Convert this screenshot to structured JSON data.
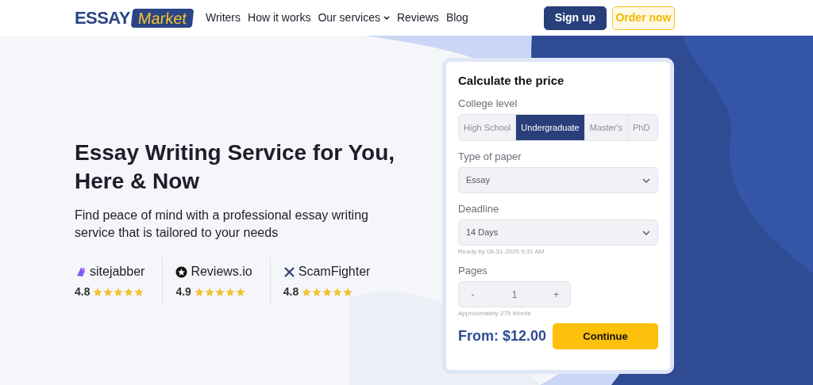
{
  "logo": {
    "word_1": "ESSAY",
    "word_2": "Market"
  },
  "nav": [
    {
      "label": "Writers",
      "has_menu": false
    },
    {
      "label": "How it works",
      "has_menu": false
    },
    {
      "label": "Our services",
      "has_menu": true
    },
    {
      "label": "Reviews",
      "has_menu": false
    },
    {
      "label": "Blog",
      "has_menu": false
    }
  ],
  "header_buttons": [
    {
      "label": "Sign up",
      "kind": "primary"
    },
    {
      "label": "Order now",
      "kind": "outline"
    }
  ],
  "hero": {
    "title": "Essay Writing Service for You, Here & Now",
    "subtitle": "Find peace of mind with a professional essay writing service that is tailored to your needs"
  },
  "ratings": [
    {
      "site": "sitejabber",
      "kind": "sitejabber",
      "score": "4.8",
      "stars": 5
    },
    {
      "site": "Reviews.io",
      "kind": "reviewsio",
      "score": "4.9",
      "stars": 5
    },
    {
      "site": "ScamFighter",
      "kind": "scamfighter",
      "score": "4.8",
      "stars": 5
    }
  ],
  "calculator": {
    "title": "Calculate the price",
    "level_label": "College level",
    "levels": [
      {
        "label": "High School",
        "selected": false
      },
      {
        "label": "Undergraduate",
        "selected": true
      },
      {
        "label": "Master's",
        "selected": false
      },
      {
        "label": "PhD",
        "selected": false
      }
    ],
    "paper_label": "Type of paper",
    "paper_value": "Essay",
    "deadline_label": "Deadline",
    "deadline_value": "14 Days",
    "deadline_note": "Ready by 08-31-2025 9:31 AM",
    "pages_label": "Pages",
    "minus": "-",
    "pages_value": "1",
    "plus": "+",
    "pages_note": "Approximately 275 Words",
    "price": "From: $12.00",
    "continue": "Continue"
  }
}
